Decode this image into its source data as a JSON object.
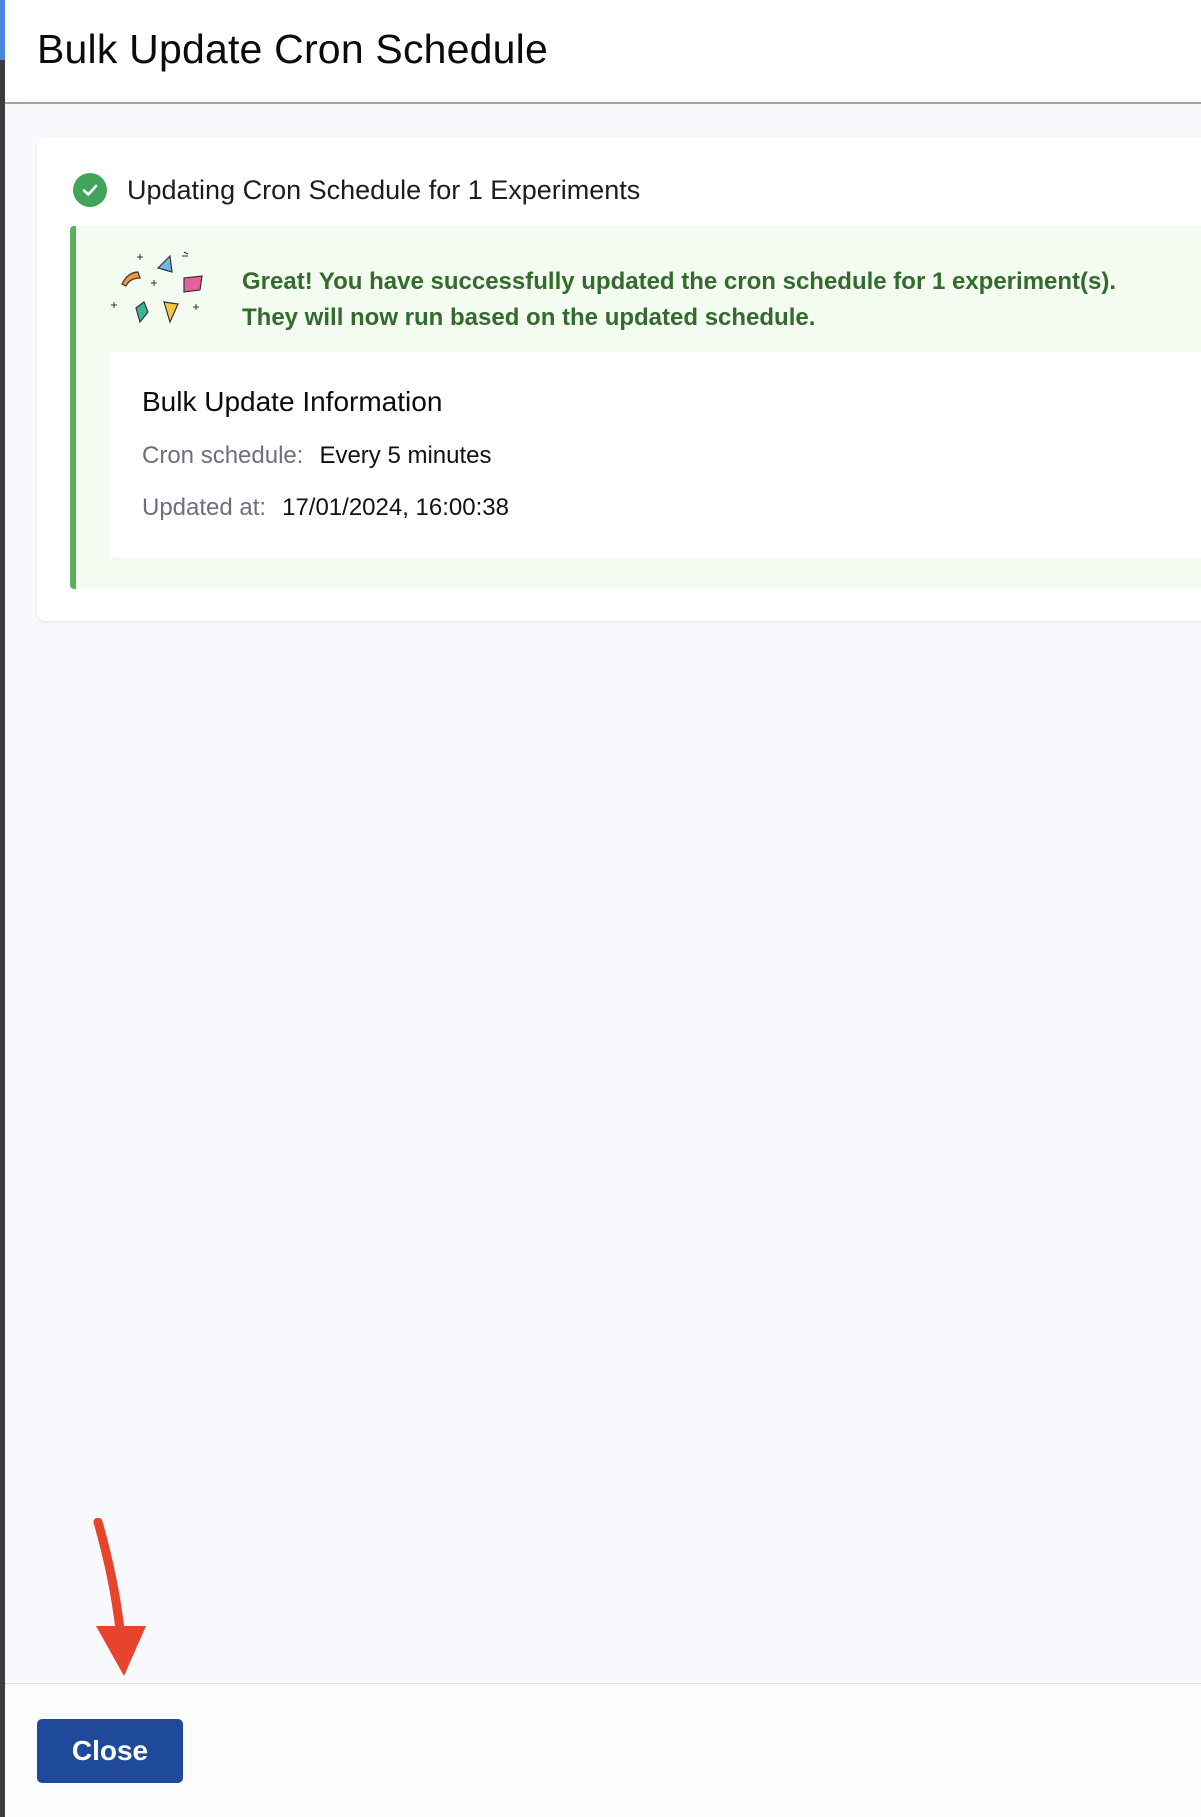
{
  "dialog": {
    "title": "Bulk Update Cron Schedule"
  },
  "status": {
    "text": "Updating Cron Schedule for 1 Experiments",
    "icon": "check-circle-icon",
    "color": "#42a45a"
  },
  "success": {
    "line1": "Great! You have successfully updated the cron schedule for 1 experiment(s).",
    "line2": "They will now run based on the updated schedule.",
    "text_color": "#336b2d",
    "border_color": "#5fae5c"
  },
  "info": {
    "title": "Bulk Update Information",
    "cron_label": "Cron schedule:",
    "cron_value": "Every 5 minutes",
    "updated_label": "Updated at:",
    "updated_value": "17/01/2024, 16:00:38"
  },
  "footer": {
    "close_label": "Close",
    "button_color": "#1f4a9c"
  },
  "annotation": {
    "arrow_color": "#e8432c",
    "icon": "red-arrow-icon"
  }
}
